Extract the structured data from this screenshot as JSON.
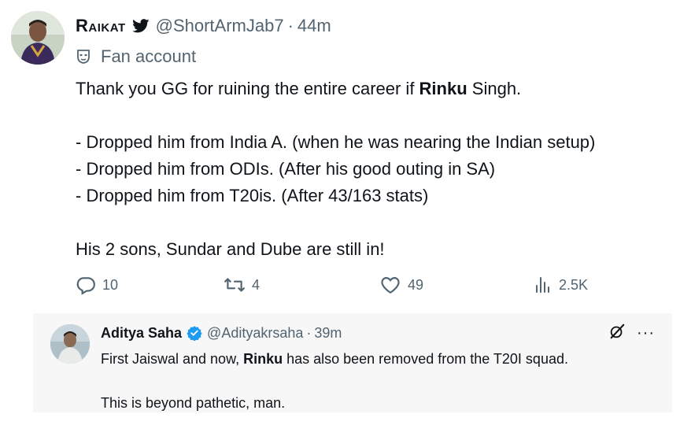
{
  "tweet": {
    "author_name": "Raikat",
    "handle": "@ShortArmJab7",
    "separator": "·",
    "time": "44m",
    "sub_label": "Fan account",
    "line1_pre": "Thank you GG for ruining the entire career if ",
    "line1_bold": "Rinku",
    "line1_post": " Singh.",
    "bullet1": "- Dropped him from India A. (when he was nearing the Indian setup)",
    "bullet2": "- Dropped him from ODIs. (After his good outing in SA)",
    "bullet3": "- Dropped him from T20is. (After 43/163 stats)",
    "closing": "His 2 sons, Sundar and Dube are still in!",
    "replies": "10",
    "retweets": "4",
    "likes": "49",
    "views": "2.5K"
  },
  "quote": {
    "author_name": "Aditya Saha",
    "handle": "@Adityakrsaha",
    "separator": "·",
    "time": "39m",
    "more": "···",
    "line1_pre": "First Jaiswal and now, ",
    "line1_bold": "Rinku",
    "line1_post": " has also been removed from the T20I squad.",
    "line2": "This is beyond pathetic, man."
  },
  "colors": {
    "muted": "#536471",
    "verified": "#1d9bf0",
    "quote_bg": "#f7f7f7"
  },
  "icons": [
    "bird-icon",
    "mask-icon",
    "reply-icon",
    "retweet-icon",
    "like-icon",
    "views-icon",
    "verified-icon",
    "grok-icon",
    "more-icon"
  ]
}
